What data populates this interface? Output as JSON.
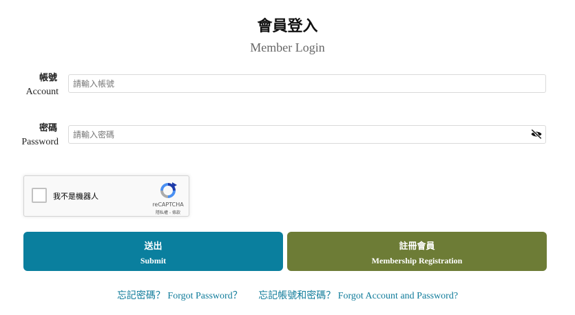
{
  "header": {
    "title": "會員登入",
    "subtitle": "Member Login"
  },
  "account": {
    "label_zh": "帳號",
    "label_en": "Account",
    "placeholder": "請輸入帳號",
    "value": ""
  },
  "password": {
    "label_zh": "密碼",
    "label_en": "Password",
    "placeholder": "請輸入密碼",
    "value": "",
    "toggle_icon": "eye-slash-icon"
  },
  "captcha": {
    "label": "我不是機器人",
    "brand": "reCAPTCHA",
    "links": "隱私權 - 條款",
    "checked": false
  },
  "buttons": {
    "submit_zh": "送出",
    "submit_en": "Submit",
    "register_zh": "註冊會員",
    "register_en": "Membership Registration"
  },
  "links": {
    "forgot_password": "忘記密碼？ Forgot Password？",
    "forgot_account": "忘記帳號和密碼？ Forgot Account and Password?"
  },
  "colors": {
    "submit": "#0a7f9e",
    "register": "#6d7c36",
    "link": "#0f7b9a"
  }
}
